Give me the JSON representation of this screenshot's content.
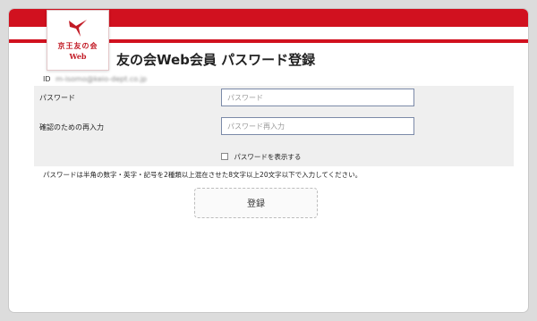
{
  "logo": {
    "name": "京王友の会",
    "sub": "Web"
  },
  "page_title": "友の会Web会員 パスワード登録",
  "user_id": {
    "label": "ID",
    "value": "m-isomo@keio-dept.co.jp"
  },
  "form": {
    "password_label": "パスワード",
    "password_placeholder": "パスワード",
    "confirm_label": "確認のための再入力",
    "confirm_placeholder": "パスワード再入力",
    "show_password_label": "パスワードを表示する"
  },
  "hint": "パスワードは半角の数字・英字・記号を2種類以上混在させた8文字以上20文字以下で入力してください。",
  "submit_label": "登録",
  "colors": {
    "brand_red": "#d1111f"
  }
}
